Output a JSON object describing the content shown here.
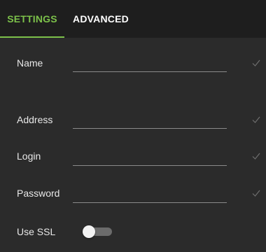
{
  "tabs": {
    "settings_label": "SETTINGS",
    "advanced_label": "ADVANCED",
    "active": "settings"
  },
  "form": {
    "name": {
      "label": "Name",
      "value": "",
      "valid": true
    },
    "address": {
      "label": "Address",
      "value": "",
      "valid": true
    },
    "login": {
      "label": "Login",
      "value": "",
      "valid": true
    },
    "password": {
      "label": "Password",
      "value": "",
      "valid": true
    },
    "use_ssl": {
      "label": "Use SSL",
      "enabled": false
    }
  },
  "colors": {
    "accent": "#7cc14a",
    "background": "#2b2b2b",
    "tabbar": "#1e1e1e",
    "text": "#e8e8e8",
    "check": "#6e6e6e"
  },
  "icons": {
    "field_valid": "check-icon"
  }
}
